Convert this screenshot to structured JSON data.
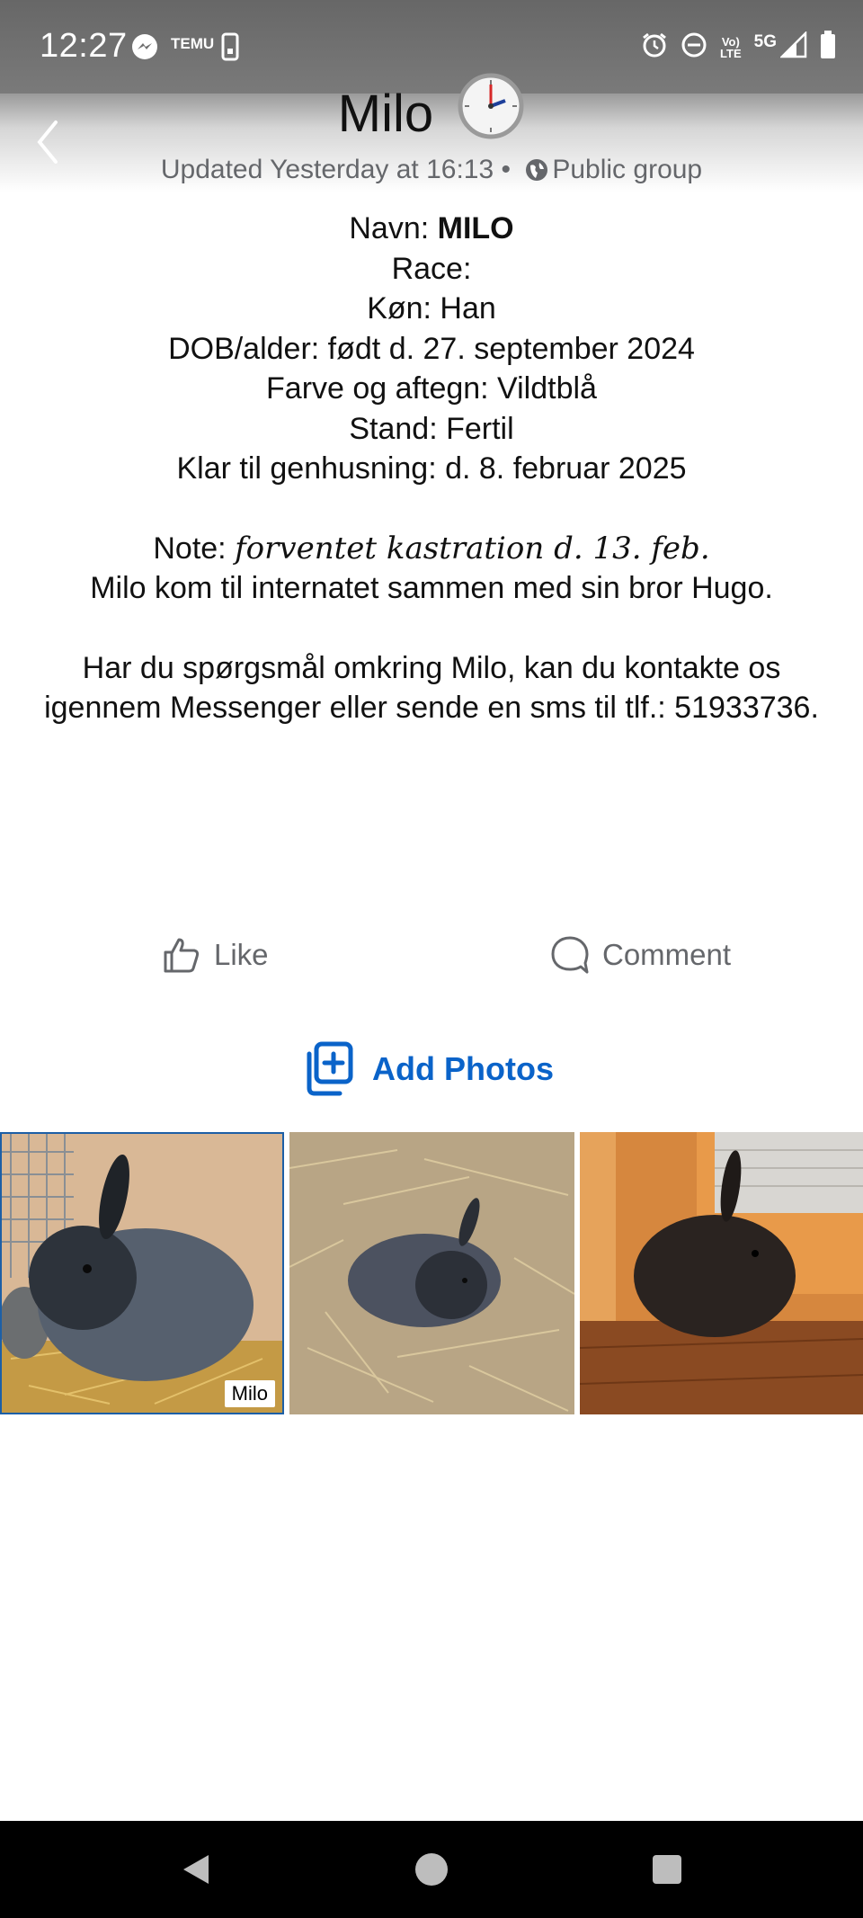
{
  "status_bar": {
    "time": "12:27",
    "temu_label": "TEMU",
    "network_label": "5G",
    "lte_label": "LTE",
    "icons": [
      "messenger-icon",
      "temu-icon",
      "phone-outline-icon",
      "alarm-icon",
      "do-not-disturb-icon",
      "volte-icon",
      "signal-icon",
      "battery-icon"
    ]
  },
  "header": {
    "title": "Milo",
    "title_emoji": "clock-icon",
    "subtitle_updated": "Updated Yesterday at 16:13 •",
    "subtitle_privacy": "Public group"
  },
  "post": {
    "navn_label": "Navn:",
    "navn_value": "MILO",
    "race": "Race:",
    "kon": "Køn: Han",
    "dob": "DOB/alder: født d. 27. september 2024",
    "farve": "Farve og aftegn: Vildtblå",
    "stand": "Stand: Fertil",
    "klar": "Klar til genhusning: d. 8. februar 2025",
    "note_label": "Note:",
    "note_text": "forventet kastration d. 13. feb.",
    "milo_line": "Milo kom til internatet sammen med sin bror Hugo.",
    "contact": "Har du spørgsmål omkring Milo, kan du kontakte os igennem Messenger eller sende en sms til tlf.: 51933736."
  },
  "actions": {
    "like_label": "Like",
    "comment_label": "Comment",
    "add_photos_label": "Add Photos"
  },
  "photos": [
    {
      "label": "Milo",
      "subject": "black rabbit in cage on straw"
    },
    {
      "subject": "black rabbit on straw"
    },
    {
      "subject": "black rabbit on wooden floor"
    }
  ],
  "colors": {
    "accent": "#0a63c9",
    "status_bar": "#6f6f6f",
    "muted_text": "#65676b",
    "nav_bar": "#000000"
  }
}
